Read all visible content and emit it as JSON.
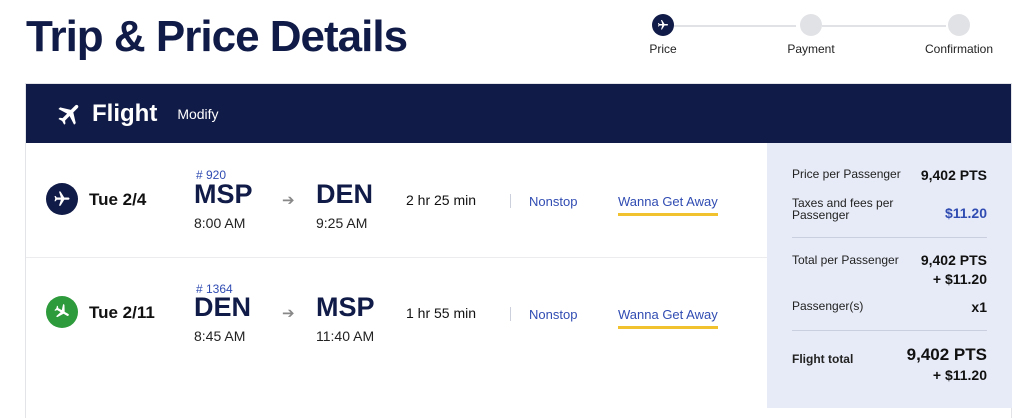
{
  "page": {
    "title": "Trip & Price Details"
  },
  "stepper": {
    "steps": [
      {
        "label": "Price",
        "active": true,
        "icon": "airplane-icon"
      },
      {
        "label": "Payment",
        "active": false
      },
      {
        "label": "Confirmation",
        "active": false
      }
    ]
  },
  "flight_card": {
    "title": "Flight",
    "modify_label": "Modify",
    "header_color": "#111b47",
    "legs": [
      {
        "date": "Tue 2/4",
        "flight_number": "# 920",
        "from_code": "MSP",
        "from_time": "8:00 AM",
        "to_code": "DEN",
        "to_time": "9:25 AM",
        "duration": "2 hr 25 min",
        "stops": "Nonstop",
        "fare": "Wanna Get Away",
        "icon_color": "#111b47"
      },
      {
        "date": "Tue 2/11",
        "flight_number": "# 1364",
        "from_code": "DEN",
        "from_time": "8:45 AM",
        "to_code": "MSP",
        "to_time": "11:40 AM",
        "duration": "1 hr 55 min",
        "stops": "Nonstop",
        "fare": "Wanna Get Away",
        "icon_color": "#2d9a3c"
      }
    ]
  },
  "summary": {
    "price_per_passenger_label": "Price per Passenger",
    "price_per_passenger_value": "9,402 PTS",
    "taxes_label": "Taxes and fees per Passenger",
    "taxes_value": "$11.20",
    "total_per_passenger_label": "Total per Passenger",
    "total_per_passenger_value_pts": "9,402 PTS",
    "total_per_passenger_value_cash": "+ $11.20",
    "passengers_label": "Passenger(s)",
    "passengers_value": "x1",
    "flight_total_label": "Flight total",
    "flight_total_value_pts": "9,402 PTS",
    "flight_total_value_cash": "+ $11.20"
  }
}
